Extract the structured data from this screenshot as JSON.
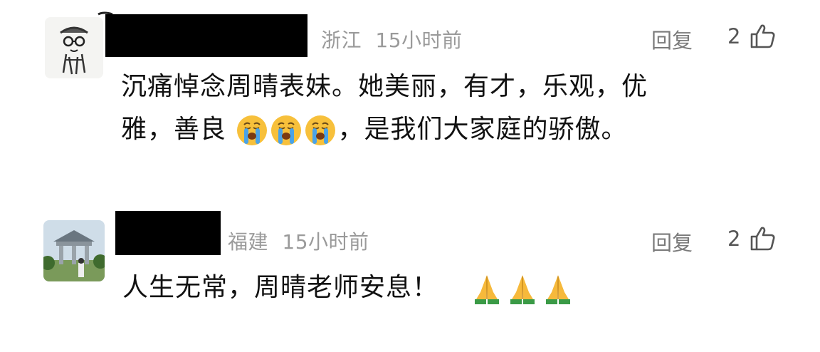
{
  "comments": [
    {
      "location": "浙江",
      "time": "15小时前",
      "reply_label": "回复",
      "like_count": "2",
      "text_line1": "沉痛悼念周晴表妹。她美丽，有才，乐观，优",
      "text_line2_a": "雅，善良",
      "text_line2_b": "，是我们大家庭的骄傲。",
      "emoji": [
        "crying-face",
        "crying-face",
        "crying-face"
      ]
    },
    {
      "location": "福建",
      "time": "15小时前",
      "reply_label": "回复",
      "like_count": "2",
      "text_a": "人生无常，周晴老师安息！",
      "emoji": [
        "folded-hands",
        "folded-hands",
        "folded-hands"
      ]
    }
  ],
  "colors": {
    "meta": "#9a9a9a",
    "text": "#111111",
    "redaction": "#000000"
  }
}
